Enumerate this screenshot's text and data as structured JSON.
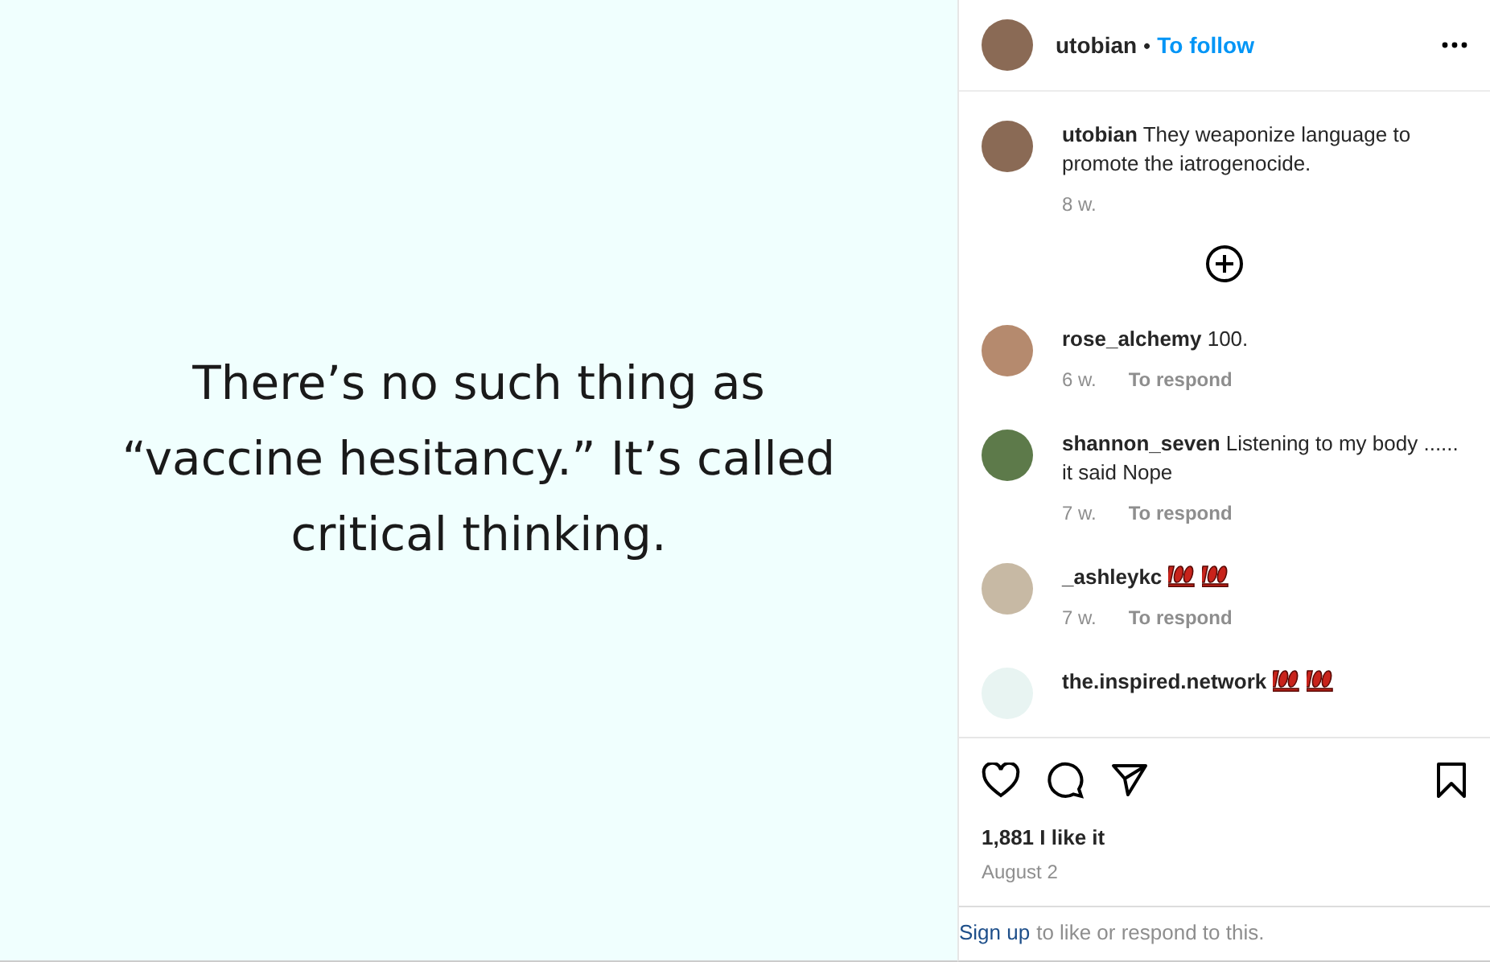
{
  "post": {
    "quote": "There’s no such thing as “vaccine hesitancy.” It’s called critical thinking."
  },
  "header": {
    "username": "utobian",
    "separator": "•",
    "follow": "To follow"
  },
  "caption": {
    "username": "utobian",
    "text": "They weaponize language to promote the iatrogenocide.",
    "time": "8 w."
  },
  "comments": [
    {
      "username": "rose_alchemy",
      "text": "100.",
      "time": "6 w.",
      "reply": "To respond"
    },
    {
      "username": "shannon_seven",
      "text": "Listening to my body ...... it said Nope",
      "time": "7 w.",
      "reply": "To respond"
    },
    {
      "username": "_ashleykc",
      "emojis": [
        {
          "kind": "hundred"
        },
        {
          "kind": "hundred"
        }
      ],
      "time": "7 w.",
      "reply": "To respond"
    },
    {
      "username": "the.inspired.network",
      "emojis": [
        {
          "kind": "hundred"
        },
        {
          "kind": "hundred"
        }
      ]
    }
  ],
  "likes": "1,881 I like it",
  "date": "August 2",
  "footer": {
    "link": "Sign up",
    "text": "to like or respond to this."
  }
}
